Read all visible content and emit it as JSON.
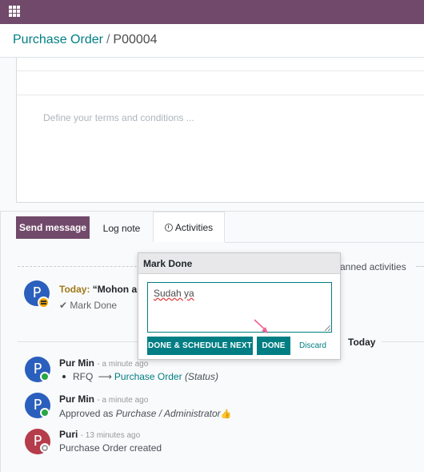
{
  "topbar": {
    "apps_icon": "apps-grid-icon",
    "color": "#71496a"
  },
  "breadcrumb": {
    "parent": "Purchase Order",
    "separator": "/",
    "current": "P00004"
  },
  "form": {
    "terms_placeholder": "Define your terms and conditions ..."
  },
  "chatter": {
    "send_message": "Send message",
    "log_note": "Log note",
    "activities": "Activities",
    "planned_label": "anned activities",
    "activity": {
      "avatar": "P",
      "today": "Today:",
      "summary": "“Mohon ap",
      "mark_done": "Mark Done"
    },
    "today_separator": "Today",
    "messages": [
      {
        "avatar": "P",
        "author": "Pur Min",
        "time": "- a minute ago",
        "from": "RFQ",
        "to": "Purchase Order",
        "field": "(Status)"
      },
      {
        "avatar": "P",
        "author": "Pur Min",
        "time": "- a minute ago",
        "body_prefix": "Approved as",
        "body_em": "Purchase / Administrator"
      },
      {
        "avatar": "P",
        "author": "Puri",
        "time": "- 13 minutes ago",
        "body": "Purchase Order created"
      }
    ]
  },
  "popover": {
    "title": "Mark Done",
    "feedback": "Sudah ya",
    "done_schedule": "DONE & SCHEDULE NEXT",
    "done": "DONE",
    "discard": "Discard"
  },
  "colors": {
    "primary": "#71496a",
    "teal": "#017e84",
    "annotation_arrow": "#f06292"
  }
}
